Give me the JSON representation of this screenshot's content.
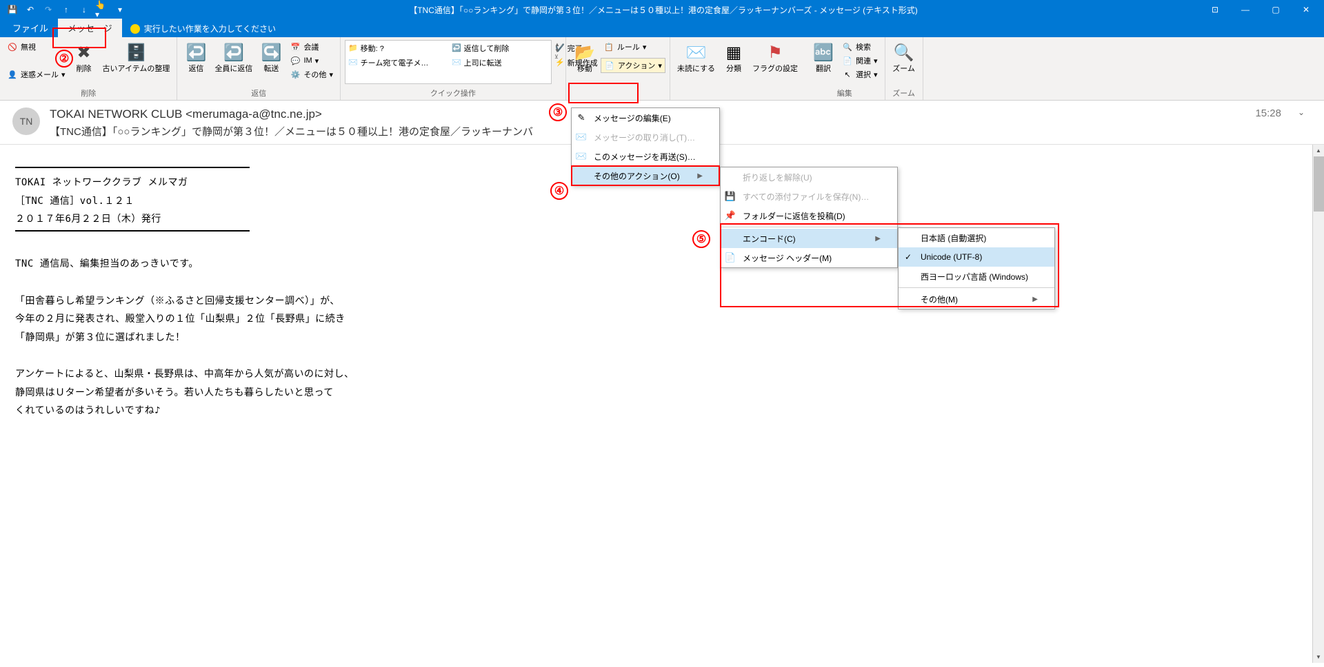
{
  "titlebar": {
    "title": "【TNC通信】「○○ランキング」で静岡が第３位！／メニューは５０種以上！港の定食屋／ラッキーナンバーズ  -  メッセージ (テキスト形式)"
  },
  "tabs": {
    "file": "ファイル",
    "message": "メッセージ"
  },
  "tellme": "実行したい作業を入力してください",
  "ribbon": {
    "delete_group": "削除",
    "ignore": "無視",
    "junk": "迷惑メール",
    "delete": "削除",
    "archive": "古いアイテムの整理",
    "respond_group": "返信",
    "reply": "返信",
    "replyall": "全員に返信",
    "forward": "転送",
    "meeting": "会議",
    "im": "IM",
    "more": "その他",
    "quicksteps_group": "クイック操作",
    "qs": {
      "move": "移動: ?",
      "team": "チーム宛て電子メ…",
      "replyDelete": "返信して削除",
      "boss": "上司に転送",
      "done": "完了",
      "new": "新規作成"
    },
    "move_group_label": "移動",
    "move_btn": "移動",
    "rules": "ルール",
    "actions": "アクション",
    "unread": "未読にする",
    "categorize": "分類",
    "flag": "フラグの設定",
    "translate": "翻訳",
    "find": "検索",
    "related": "関連",
    "select": "選択",
    "edit_group": "編集",
    "zoom": "ズーム",
    "zoom_group": "ズーム"
  },
  "message": {
    "from": "TOKAI NETWORK CLUB <merumaga-a@tnc.ne.jp>",
    "subject": "【TNC通信】「○○ランキング」で静岡が第３位！／メニューは５０種以上！港の定食屋／ラッキーナンバ",
    "time": "15:28",
    "avatar": "TN",
    "body": [
      "TOKAI ネットワーククラブ メルマガ",
      "［TNC 通信］vol.１２１",
      "２０１７年6月２２日（木）発行",
      "",
      "TNC 通信局、編集担当のあっきいです。",
      "",
      "「田舎暮らし希望ランキング（※ふるさと回帰支援センター調べ）」が、",
      "今年の２月に発表され、殿堂入りの１位「山梨県」２位「長野県」に続き",
      "「静岡県」が第３位に選ばれました！",
      "",
      "アンケートによると、山梨県・長野県は、中高年から人気が高いのに対し、",
      "静岡県はＵターン希望者が多いそう。若い人たちも暮らしたいと思って",
      "くれているのはうれしいですね♪"
    ]
  },
  "actions_menu": {
    "edit_msg": "メッセージの編集(E)",
    "recall": "メッセージの取り消し(T)…",
    "resend": "このメッセージを再送(S)…",
    "other": "その他のアクション(O)"
  },
  "other_menu": {
    "unwrap": "折り返しを解除(U)",
    "save_attach": "すべての添付ファイルを保存(N)…",
    "post_reply": "フォルダーに返信を投稿(D)",
    "encoding": "エンコード(C)",
    "headers": "メッセージ ヘッダー(M)"
  },
  "encoding_menu": {
    "auto_jp": "日本語 (自動選択)",
    "utf8": "Unicode (UTF-8)",
    "western": "西ヨーロッパ言語 (Windows)",
    "other": "その他(M)"
  },
  "annotations": {
    "n2": "②",
    "n3": "③",
    "n4": "④",
    "n5": "⑤"
  }
}
